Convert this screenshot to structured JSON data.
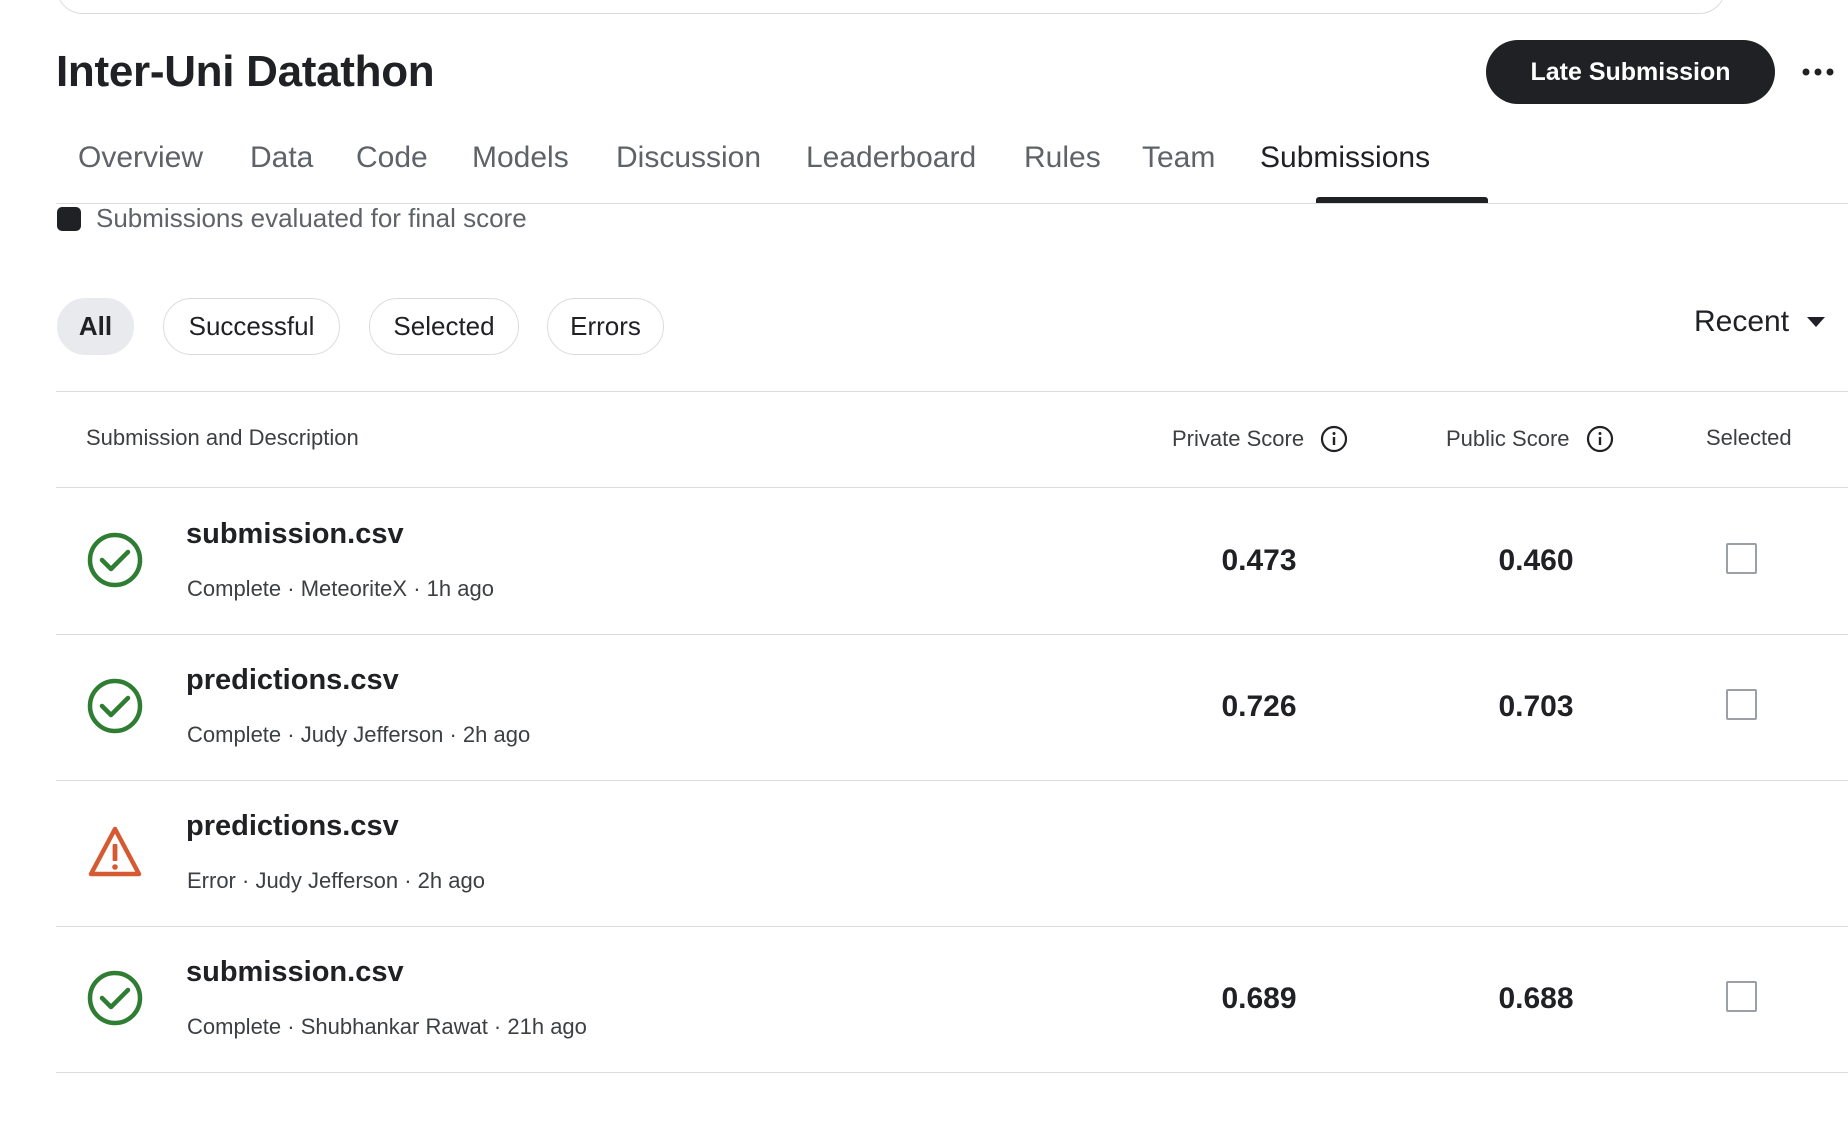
{
  "header": {
    "title": "Inter-Uni Datathon",
    "late_submission_label": "Late Submission",
    "more_icon": "more-horizontal-icon"
  },
  "tabs": [
    {
      "label": "Overview"
    },
    {
      "label": "Data"
    },
    {
      "label": "Code"
    },
    {
      "label": "Models"
    },
    {
      "label": "Discussion"
    },
    {
      "label": "Leaderboard"
    },
    {
      "label": "Rules"
    },
    {
      "label": "Team"
    },
    {
      "label": "Submissions",
      "active": true
    }
  ],
  "legend": {
    "label": "Submissions evaluated for final score",
    "swatch_color": "#202124"
  },
  "filters": {
    "chips": [
      {
        "label": "All",
        "active": true
      },
      {
        "label": "Successful"
      },
      {
        "label": "Selected"
      },
      {
        "label": "Errors"
      }
    ],
    "sort_label": "Recent"
  },
  "table": {
    "headers": {
      "submission": "Submission and Description",
      "private": "Private Score",
      "public": "Public Score",
      "selected": "Selected"
    },
    "rows": [
      {
        "status": "success",
        "file": "submission.csv",
        "meta": "Complete · MeteoriteX · 1h ago",
        "private": "0.473",
        "public": "0.460",
        "selected": false
      },
      {
        "status": "success",
        "file": "predictions.csv",
        "meta": "Complete · Judy Jefferson · 2h ago",
        "private": "0.726",
        "public": "0.703",
        "selected": false
      },
      {
        "status": "error",
        "file": "predictions.csv",
        "meta": "Error · Judy Jefferson · 2h ago",
        "private": "",
        "public": "",
        "selected": null
      },
      {
        "status": "success",
        "file": "submission.csv",
        "meta": "Complete · Shubhankar Rawat · 21h ago",
        "private": "0.689",
        "public": "0.688",
        "selected": false
      }
    ]
  },
  "colors": {
    "success": "#2e7d32",
    "error": "#d65a31",
    "primary_button": "#202124"
  }
}
